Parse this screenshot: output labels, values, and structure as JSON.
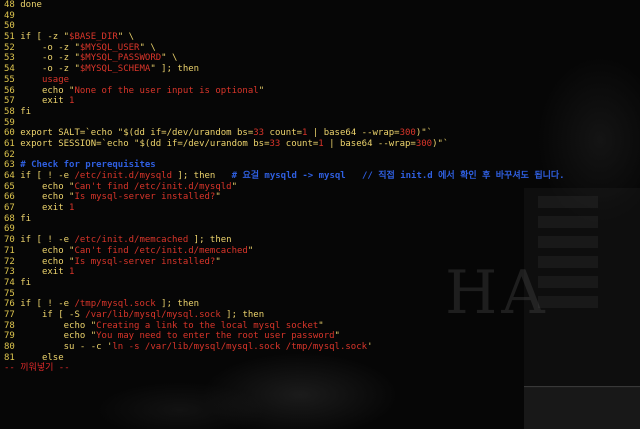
{
  "editor": {
    "mode_line": "-- 끼워넣기 --",
    "lines": [
      {
        "num": "48",
        "segments": [
          {
            "t": "done",
            "c": "y"
          }
        ]
      },
      {
        "num": "49",
        "segments": []
      },
      {
        "num": "50",
        "segments": []
      },
      {
        "num": "51",
        "segments": [
          {
            "t": "if [ -z \"",
            "c": "y"
          },
          {
            "t": "$BASE_DIR",
            "c": "s"
          },
          {
            "t": "\" \\",
            "c": "y"
          }
        ]
      },
      {
        "num": "52",
        "segments": [
          {
            "t": "    -o -z \"",
            "c": "y"
          },
          {
            "t": "$MYSQL_USER",
            "c": "s"
          },
          {
            "t": "\" \\",
            "c": "y"
          }
        ]
      },
      {
        "num": "53",
        "segments": [
          {
            "t": "    -o -z \"",
            "c": "y"
          },
          {
            "t": "$MYSQL_PASSWORD",
            "c": "s"
          },
          {
            "t": "\" \\",
            "c": "y"
          }
        ]
      },
      {
        "num": "54",
        "segments": [
          {
            "t": "    -o -z \"",
            "c": "y"
          },
          {
            "t": "$MYSQL_SCHEMA",
            "c": "s"
          },
          {
            "t": "\" ]; then",
            "c": "y"
          }
        ]
      },
      {
        "num": "55",
        "segments": [
          {
            "t": "    usage",
            "c": "s"
          }
        ]
      },
      {
        "num": "56",
        "segments": [
          {
            "t": "    echo \"",
            "c": "y"
          },
          {
            "t": "None of the user input is optional",
            "c": "s"
          },
          {
            "t": "\"",
            "c": "y"
          }
        ]
      },
      {
        "num": "57",
        "segments": [
          {
            "t": "    exit ",
            "c": "y"
          },
          {
            "t": "1",
            "c": "s"
          }
        ]
      },
      {
        "num": "58",
        "segments": [
          {
            "t": "fi",
            "c": "y"
          }
        ]
      },
      {
        "num": "59",
        "segments": []
      },
      {
        "num": "60",
        "segments": [
          {
            "t": "export SALT=`echo \"$(dd if=/dev/urandom bs=",
            "c": "y"
          },
          {
            "t": "33",
            "c": "s"
          },
          {
            "t": " count=",
            "c": "y"
          },
          {
            "t": "1",
            "c": "s"
          },
          {
            "t": " | base64 --wrap=",
            "c": "y"
          },
          {
            "t": "300",
            "c": "s"
          },
          {
            "t": ")\"`",
            "c": "y"
          }
        ]
      },
      {
        "num": "61",
        "segments": [
          {
            "t": "export SESSION=`echo \"$(dd if=/dev/urandom bs=",
            "c": "y"
          },
          {
            "t": "33",
            "c": "s"
          },
          {
            "t": " count=",
            "c": "y"
          },
          {
            "t": "1",
            "c": "s"
          },
          {
            "t": " | base64 --wrap=",
            "c": "y"
          },
          {
            "t": "300",
            "c": "s"
          },
          {
            "t": ")\"`",
            "c": "y"
          }
        ]
      },
      {
        "num": "62",
        "segments": []
      },
      {
        "num": "63",
        "segments": [
          {
            "t": "# Check for prerequisites",
            "c": "b"
          }
        ]
      },
      {
        "num": "64",
        "segments": [
          {
            "t": "if [ ! -e ",
            "c": "y"
          },
          {
            "t": "/etc/init.d/mysqld",
            "c": "s"
          },
          {
            "t": " ]; then   ",
            "c": "y"
          },
          {
            "t": "# 요걸 mysqld -> mysql   // 직접 init.d 에서 확인 후 바꾸셔도 됩니다.",
            "c": "b"
          }
        ]
      },
      {
        "num": "65",
        "segments": [
          {
            "t": "    echo \"",
            "c": "y"
          },
          {
            "t": "Can't find /etc/init.d/mysqld",
            "c": "s"
          },
          {
            "t": "\"",
            "c": "y"
          }
        ]
      },
      {
        "num": "66",
        "segments": [
          {
            "t": "    echo \"",
            "c": "y"
          },
          {
            "t": "Is mysql-server installed?",
            "c": "s"
          },
          {
            "t": "\"",
            "c": "y"
          }
        ]
      },
      {
        "num": "67",
        "segments": [
          {
            "t": "    exit ",
            "c": "y"
          },
          {
            "t": "1",
            "c": "s"
          }
        ]
      },
      {
        "num": "68",
        "segments": [
          {
            "t": "fi",
            "c": "y"
          }
        ]
      },
      {
        "num": "69",
        "segments": []
      },
      {
        "num": "70",
        "segments": [
          {
            "t": "if [ ! -e ",
            "c": "y"
          },
          {
            "t": "/etc/init.d/memcached",
            "c": "s"
          },
          {
            "t": " ]; then",
            "c": "y"
          }
        ]
      },
      {
        "num": "71",
        "segments": [
          {
            "t": "    echo \"",
            "c": "y"
          },
          {
            "t": "Can't find /etc/init.d/memcached",
            "c": "s"
          },
          {
            "t": "\"",
            "c": "y"
          }
        ]
      },
      {
        "num": "72",
        "segments": [
          {
            "t": "    echo \"",
            "c": "y"
          },
          {
            "t": "Is mysql-server installed?",
            "c": "s"
          },
          {
            "t": "\"",
            "c": "y"
          }
        ]
      },
      {
        "num": "73",
        "segments": [
          {
            "t": "    exit ",
            "c": "y"
          },
          {
            "t": "1",
            "c": "s"
          }
        ]
      },
      {
        "num": "74",
        "segments": [
          {
            "t": "fi",
            "c": "y"
          }
        ]
      },
      {
        "num": "75",
        "segments": []
      },
      {
        "num": "76",
        "segments": [
          {
            "t": "if [ ! -e ",
            "c": "y"
          },
          {
            "t": "/tmp/mysql.sock",
            "c": "s"
          },
          {
            "t": " ]; then",
            "c": "y"
          }
        ]
      },
      {
        "num": "77",
        "segments": [
          {
            "t": "    if [ -S ",
            "c": "y"
          },
          {
            "t": "/var/lib/mysql/mysql.sock",
            "c": "s"
          },
          {
            "t": " ]; then",
            "c": "y"
          }
        ]
      },
      {
        "num": "78",
        "segments": [
          {
            "t": "        echo \"",
            "c": "y"
          },
          {
            "t": "Creating a link to the local mysql socket",
            "c": "s"
          },
          {
            "t": "\"",
            "c": "y"
          }
        ]
      },
      {
        "num": "79",
        "segments": [
          {
            "t": "        echo \"",
            "c": "y"
          },
          {
            "t": "You may need to enter the root user password",
            "c": "s"
          },
          {
            "t": "\"",
            "c": "y"
          }
        ]
      },
      {
        "num": "80",
        "segments": [
          {
            "t": "        su - -c '",
            "c": "y"
          },
          {
            "t": "ln -s /var/lib/mysql/mysql.sock /tmp/mysql.sock",
            "c": "s"
          },
          {
            "t": "'",
            "c": "y"
          }
        ]
      },
      {
        "num": "81",
        "segments": [
          {
            "t": "    else",
            "c": "y"
          }
        ]
      }
    ]
  },
  "colors": {
    "keyword": "#ecd36c",
    "string": "#d9352a",
    "comment": "#2f5fe0",
    "status": "#e32b2b",
    "background": "#060606"
  }
}
